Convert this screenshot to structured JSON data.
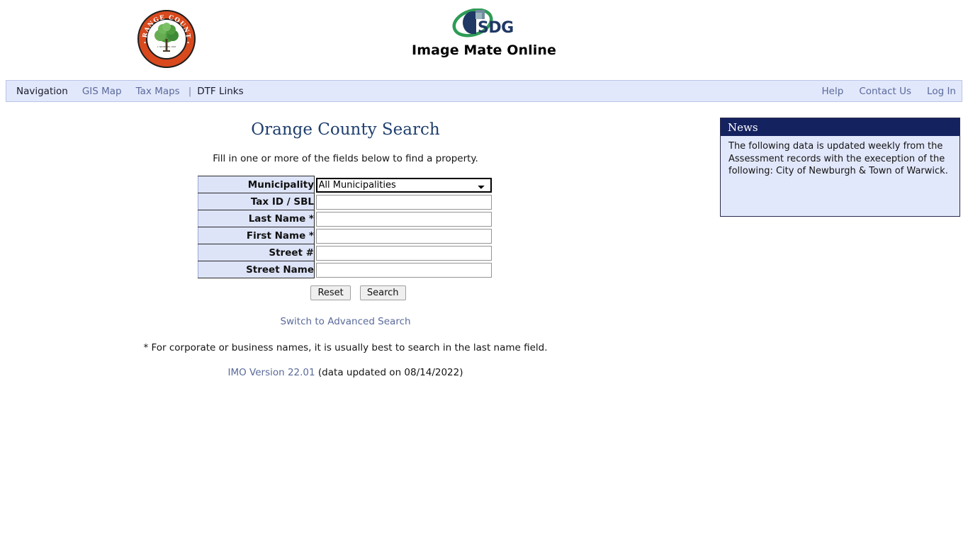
{
  "header": {
    "seal_alt": "Orange County New York seal",
    "seal_text_top": "ORANGE COUNTY",
    "seal_text_bottom": "NEW YORK",
    "logo_text": "SDG",
    "app_title": "Image Mate Online"
  },
  "navbar": {
    "left_items": [
      {
        "label": "Navigation",
        "style": "strong",
        "name": "nav-navigation"
      },
      {
        "label": "GIS Map",
        "style": "link",
        "name": "nav-gis-map"
      },
      {
        "label": "Tax Maps",
        "style": "link",
        "name": "nav-tax-maps"
      },
      {
        "label": "|",
        "style": "separator",
        "name": "nav-separator"
      },
      {
        "label": "DTF Links",
        "style": "strong",
        "name": "nav-dtf-links"
      }
    ],
    "right_items": [
      {
        "label": "Help",
        "name": "nav-help"
      },
      {
        "label": "Contact Us",
        "name": "nav-contact-us"
      },
      {
        "label": "Log In",
        "name": "nav-log-in"
      }
    ]
  },
  "search": {
    "title": "Orange County Search",
    "subtitle": "Fill in one or more of the fields below to find a property.",
    "fields": [
      {
        "label": "Municipality",
        "type": "select",
        "value": "All Municipalities",
        "placeholder": ""
      },
      {
        "label": "Tax ID / SBL",
        "type": "text",
        "value": "",
        "placeholder": ""
      },
      {
        "label": "Last Name *",
        "type": "text",
        "value": "",
        "placeholder": ""
      },
      {
        "label": "First Name *",
        "type": "text",
        "value": "",
        "placeholder": ""
      },
      {
        "label": "Street #",
        "type": "text",
        "value": "",
        "placeholder": ""
      },
      {
        "label": "Street Name",
        "type": "text",
        "value": "",
        "placeholder": ""
      }
    ],
    "municipality_options": [
      "All Municipalities"
    ],
    "reset_label": "Reset",
    "search_label": "Search",
    "advanced_link": "Switch to Advanced Search",
    "footnote": "* For corporate or business names, it is usually best to search in the last name field.",
    "version_link": "IMO Version 22.01",
    "version_suffix": " (data updated on 08/14/2022)"
  },
  "news": {
    "title": "News",
    "body": "The following data is updated weekly from the Assessment records with the exeception of the following:  City of Newburgh & Town of Warwick."
  },
  "colors": {
    "nav_background": "#e2e8fb",
    "label_background": "#dde4f8",
    "news_header": "#152260",
    "title_text": "#1f3f6e",
    "link_text": "#5a6a9b"
  }
}
